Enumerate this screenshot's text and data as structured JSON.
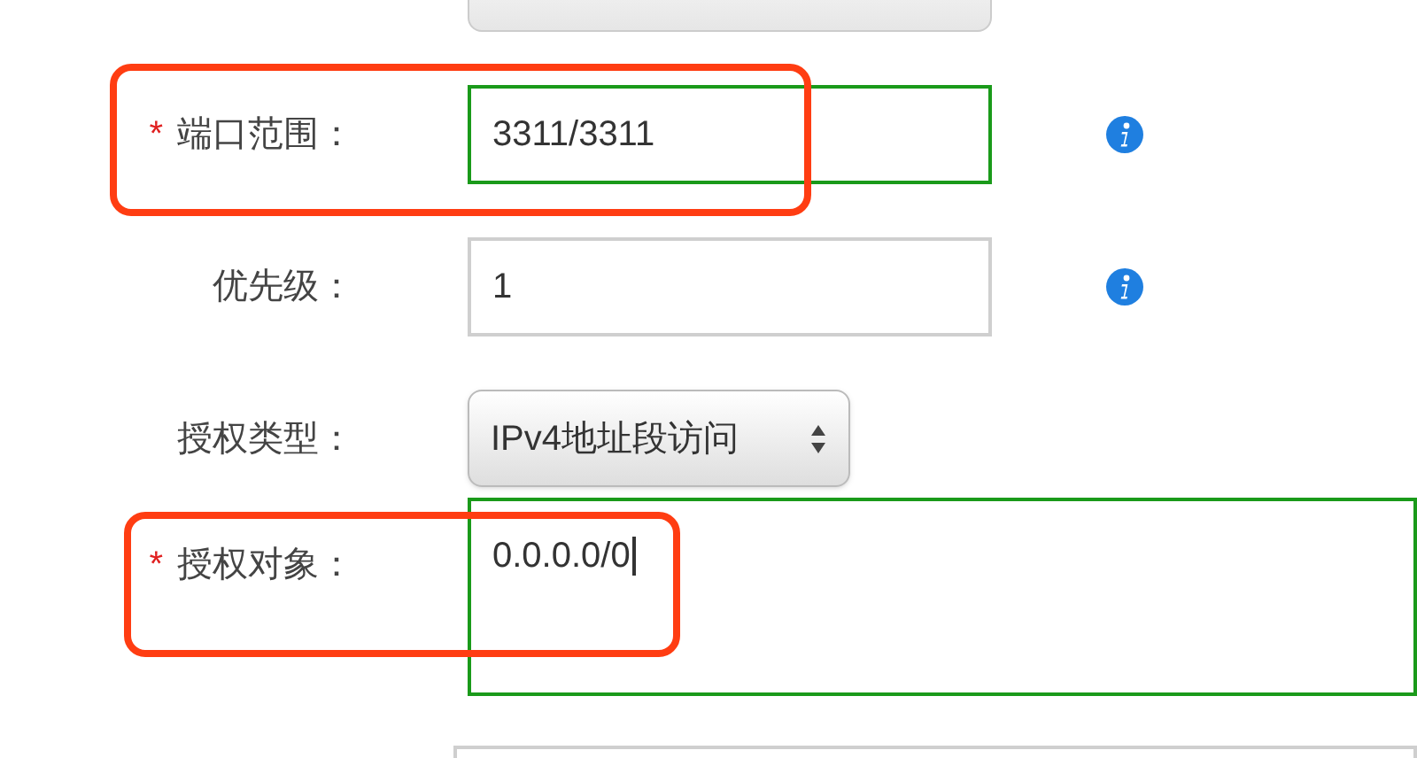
{
  "fields": [
    {
      "kind": "input",
      "required_mark": "*",
      "label": "端口范围：",
      "value": "3311/3311",
      "focused": true,
      "info": true,
      "highlighted": true
    },
    {
      "kind": "input",
      "label": "优先级：",
      "value": "1",
      "focused": false,
      "info": true,
      "highlighted": false
    },
    {
      "kind": "select",
      "label": "授权类型：",
      "value": "IPv4地址段访问",
      "focused": false,
      "info": false,
      "highlighted": false
    },
    {
      "kind": "textarea",
      "required_mark": "*",
      "label": "授权对象：",
      "value": "0.0.0.0/0",
      "focused": true,
      "info": false,
      "highlighted": true
    }
  ]
}
